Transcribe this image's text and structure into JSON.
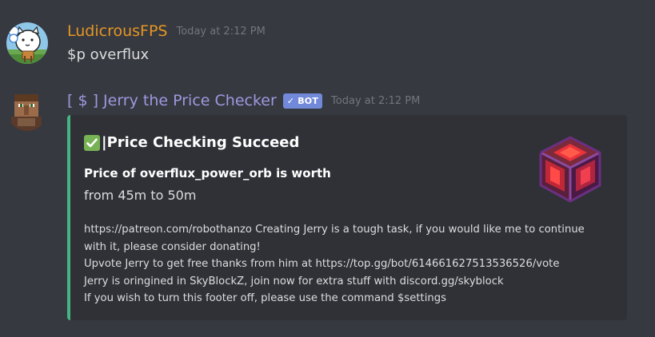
{
  "messages": [
    {
      "username": "LudicrousFPS",
      "timestamp": "Today at 2:12 PM",
      "content": "$p overflux",
      "avatar_icon": "battle-cats-avatar-icon"
    },
    {
      "username": "[ $ ] Jerry the Price Checker",
      "bot_tag": "BOT",
      "bot_check": "✓",
      "timestamp": "Today at 2:12 PM",
      "avatar_icon": "villager-avatar-icon",
      "embed": {
        "accent_color": "#43b581",
        "title_emoji": "✓",
        "title": "|Price Checking Succeed",
        "field_name": "Price of overflux_power_orb is worth",
        "field_value": "from 45m to 50m",
        "thumbnail_icon": "power-orb-icon",
        "footer_lines": [
          "https://patreon.com/robothanzo Creating Jerry is a tough task, if you would like me to continue",
          "with it, please consider donating!",
          "Upvote Jerry to get free thanks from him at https://top.gg/bot/614661627513536526/vote",
          "Jerry is oringined in SkyBlockZ, join now for extra stuff with discord.gg/skyblock",
          "If you wish to turn this footer off, please use the command $settings"
        ]
      }
    }
  ],
  "colors": {
    "background": "#36393f",
    "embed_background": "#2f3136",
    "user1_name": "#e69624",
    "user2_name": "#9f98e0",
    "bot_tag": "#7289da",
    "timestamp": "#72767d",
    "text": "#dcddde"
  }
}
